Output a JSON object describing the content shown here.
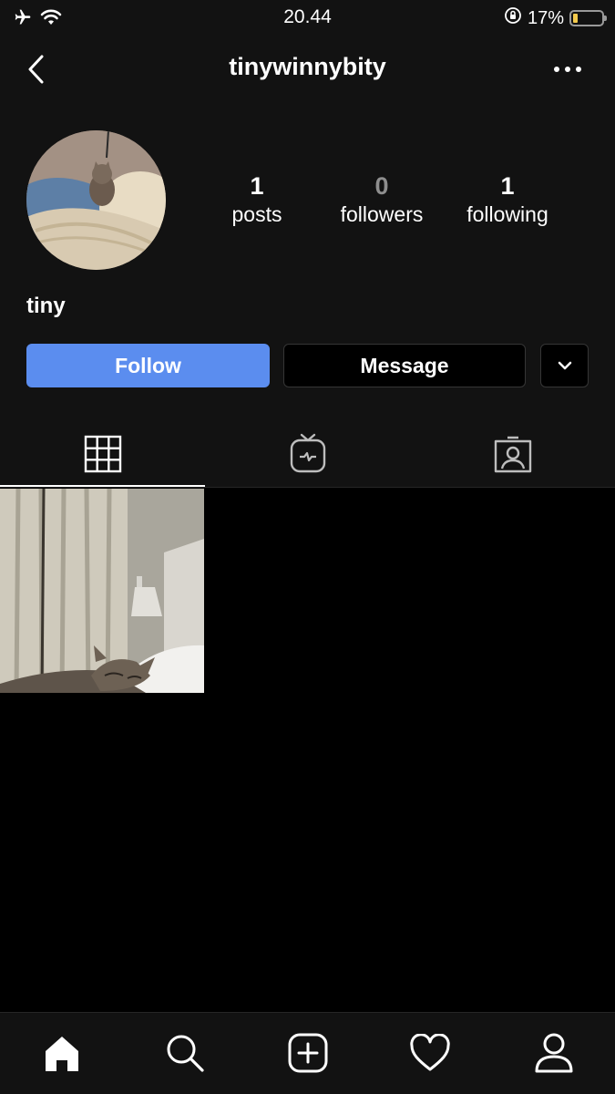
{
  "status_bar": {
    "time": "20.44",
    "battery_percent": "17%",
    "battery_level": 0.17,
    "battery_color": "#f2c94c",
    "icons": [
      "airplane-icon",
      "wifi-icon",
      "orientation-lock-icon",
      "battery-icon"
    ]
  },
  "header": {
    "username": "tinywinnybity",
    "back_icon": "chevron-left-icon",
    "more_icon": "ellipsis-icon"
  },
  "profile": {
    "name": "tiny",
    "stats": [
      {
        "count": "1",
        "label": "posts"
      },
      {
        "count": "0",
        "label": "followers"
      },
      {
        "count": "1",
        "label": "following"
      }
    ]
  },
  "actions": {
    "follow_label": "Follow",
    "message_label": "Message",
    "dropdown_icon": "chevron-down-icon",
    "follow_color": "#5b8def"
  },
  "tabs": [
    {
      "icon": "grid-icon",
      "active": true
    },
    {
      "icon": "igtv-icon",
      "active": false
    },
    {
      "icon": "tagged-icon",
      "active": false
    }
  ],
  "posts": [
    {
      "description_icon": "photo-thumbnail"
    }
  ],
  "bottom_nav": [
    {
      "icon": "home-icon",
      "active": true
    },
    {
      "icon": "search-icon",
      "active": false
    },
    {
      "icon": "new-post-icon",
      "active": false
    },
    {
      "icon": "heart-icon",
      "active": false
    },
    {
      "icon": "profile-icon",
      "active": false
    }
  ]
}
